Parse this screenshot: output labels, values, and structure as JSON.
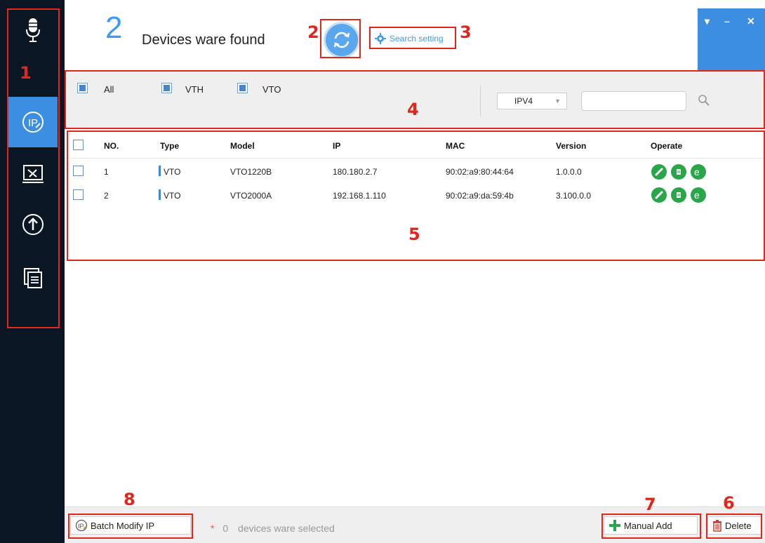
{
  "header": {
    "device_count": "2",
    "found_text": "Devices ware found",
    "search_setting_label": "Search setting",
    "win_controls": [
      "▾",
      "–",
      "✕"
    ]
  },
  "sidebar": {
    "items": [
      {
        "icon": "microphone-icon"
      },
      {
        "icon": "ip-config-icon",
        "active": true
      },
      {
        "icon": "tools-icon"
      },
      {
        "icon": "upgrade-icon"
      },
      {
        "icon": "document-icon"
      }
    ]
  },
  "filter": {
    "all_label": "All",
    "vth_label": "VTH",
    "vto_label": "VTO",
    "ip_version": "IPV4",
    "search_value": ""
  },
  "table": {
    "columns": [
      "NO.",
      "Type",
      "Model",
      "IP",
      "MAC",
      "Version",
      "Operate"
    ],
    "rows": [
      {
        "no": "1",
        "type": "VTO",
        "model": "VTO1220B",
        "ip": "180.180.2.7",
        "mac": "90:02:a9:80:44:64",
        "version": "1.0.0.0"
      },
      {
        "no": "2",
        "type": "VTO",
        "model": "VTO2000A",
        "ip": "192.168.1.110",
        "mac": "90:02:a9:da:59:4b",
        "version": "3.100.0.0"
      }
    ]
  },
  "footer": {
    "batch_modify_label": "Batch Modify IP",
    "selected_star": "*",
    "selected_count": "0",
    "selected_text": "devices ware selected",
    "manual_add_label": "Manual Add",
    "delete_label": "Delete"
  },
  "annotations": [
    "1",
    "2",
    "3",
    "4",
    "5",
    "6",
    "7",
    "8"
  ],
  "colors": {
    "accent": "#3b8ee0",
    "sidebar_bg": "#0b1624",
    "annotation_red": "#e3261b",
    "operate_green": "#2aa64a"
  }
}
